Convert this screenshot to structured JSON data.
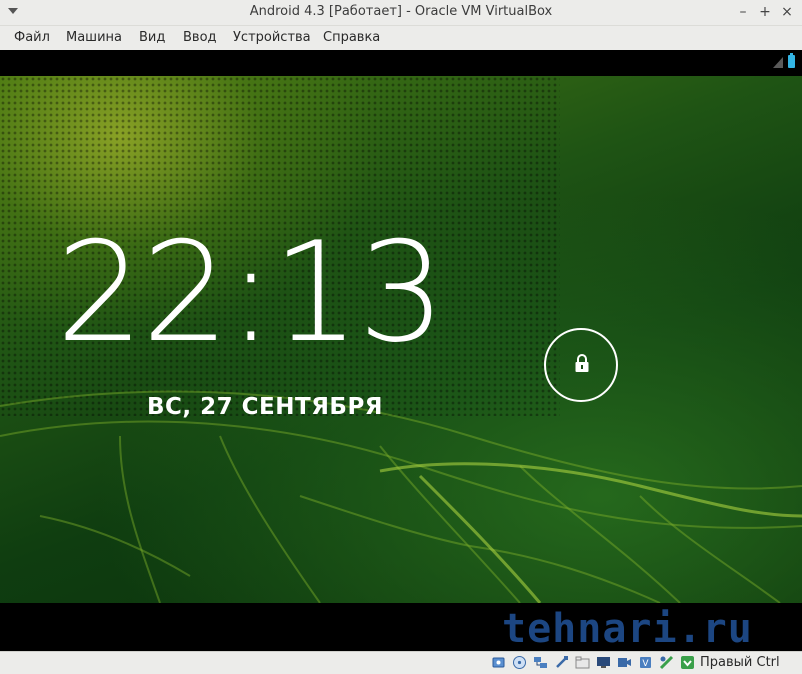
{
  "window": {
    "title": "Android 4.3 [Работает] - Oracle VM VirtualBox",
    "controls": {
      "minimize": "–",
      "maximize": "+",
      "close": "×"
    }
  },
  "menu": {
    "items": [
      "Файл",
      "Машина",
      "Вид",
      "Ввод",
      "Устройства",
      "Справка"
    ]
  },
  "lockscreen": {
    "time_hours": "22",
    "time_colon": ":",
    "time_minutes": "13",
    "date": "ВС, 27 СЕНТЯБРЯ"
  },
  "watermark": "tehnari.ru",
  "statusbar": {
    "icons": [
      "hard-disk-icon",
      "optical-disk-icon",
      "network-icon",
      "usb-icon",
      "shared-folders-icon",
      "display-icon",
      "video-capture-icon",
      "virtualization-icon",
      "mouse-integration-icon",
      "guest-additions-icon"
    ],
    "host_key": "Правый Ctrl"
  },
  "colors": {
    "accent_blue": "#33b5e5",
    "watermark": "#1e4a8a"
  }
}
